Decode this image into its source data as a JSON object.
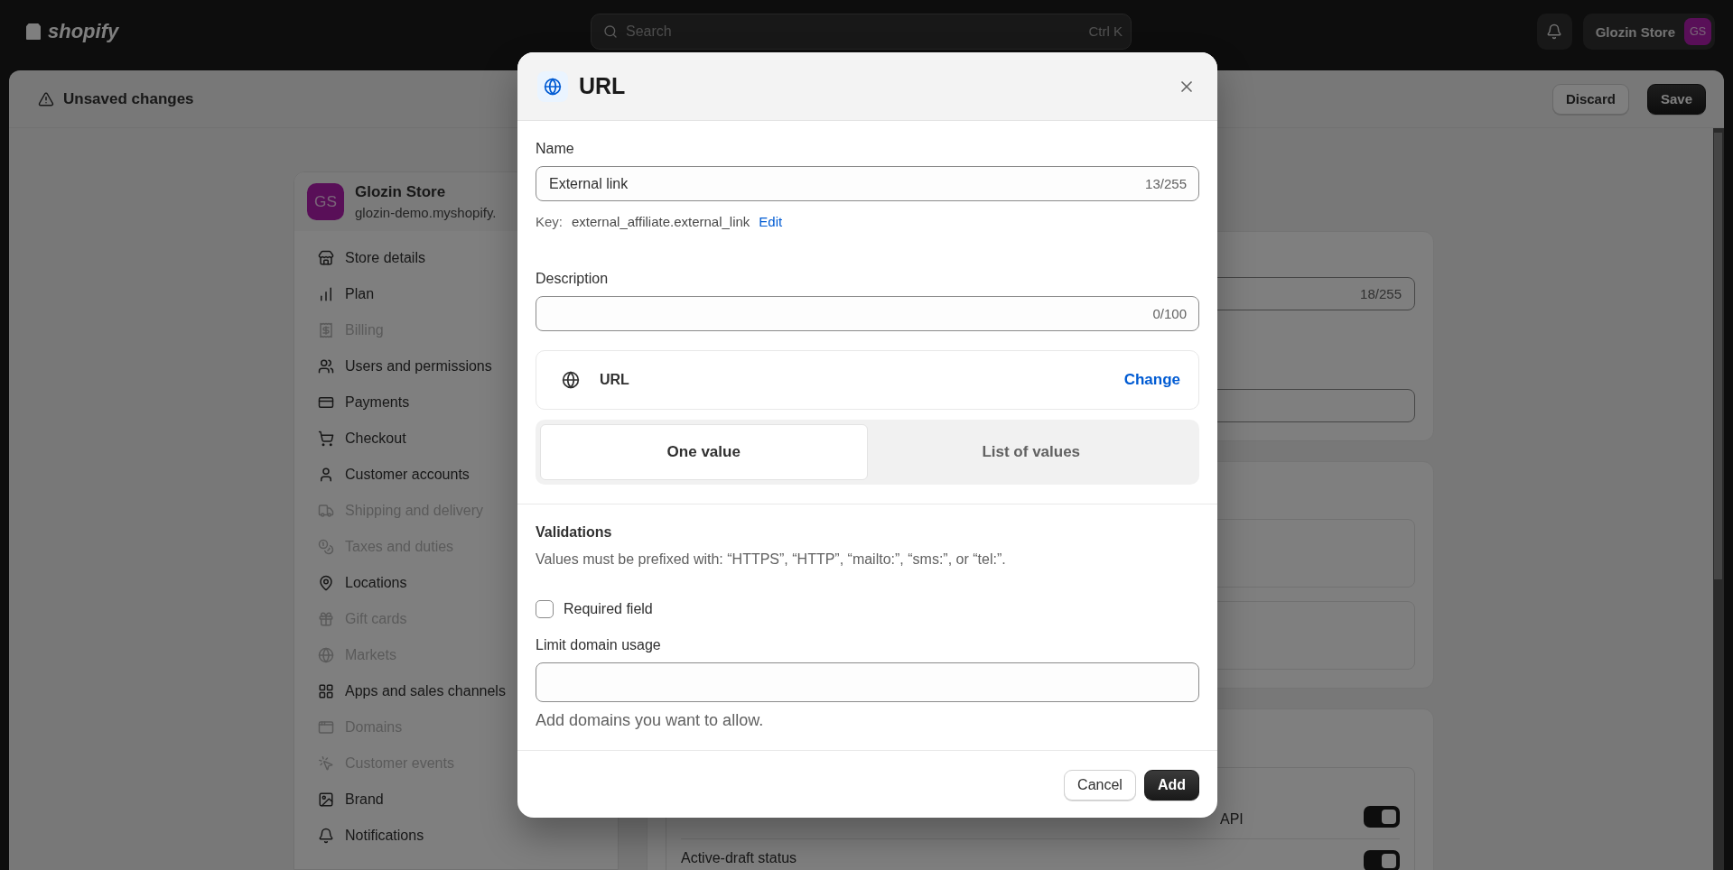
{
  "topbar": {
    "logo": "shopify",
    "search": {
      "placeholder": "Search",
      "shortcut": "Ctrl K"
    },
    "store_button": {
      "label": "Glozin Store",
      "avatar": "GS"
    }
  },
  "save_bar": {
    "title": "Unsaved changes",
    "buttons": [
      {
        "label": "Discard",
        "kind": "secondary"
      },
      {
        "label": "Save",
        "kind": "primary"
      }
    ]
  },
  "sidebar": {
    "store": {
      "avatar": "GS",
      "name": "Glozin Store",
      "domain": "glozin-demo.myshopify."
    },
    "items": [
      {
        "label": "Store details",
        "disabled": false
      },
      {
        "label": "Plan",
        "disabled": false
      },
      {
        "label": "Billing",
        "disabled": true
      },
      {
        "label": "Users and permissions",
        "disabled": false
      },
      {
        "label": "Payments",
        "disabled": false
      },
      {
        "label": "Checkout",
        "disabled": false
      },
      {
        "label": "Customer accounts",
        "disabled": false
      },
      {
        "label": "Shipping and delivery",
        "disabled": true
      },
      {
        "label": "Taxes and duties",
        "disabled": true
      },
      {
        "label": "Locations",
        "disabled": false
      },
      {
        "label": "Gift cards",
        "disabled": true
      },
      {
        "label": "Markets",
        "disabled": true
      },
      {
        "label": "Apps and sales channels",
        "disabled": false
      },
      {
        "label": "Domains",
        "disabled": true
      },
      {
        "label": "Customer events",
        "disabled": true
      },
      {
        "label": "Brand",
        "disabled": false
      },
      {
        "label": "Notifications",
        "disabled": false
      }
    ]
  },
  "background": {
    "name_counter": "18/255",
    "rows": [
      {
        "text": "API",
        "on": true
      },
      {
        "text": "Active-draft status",
        "on": true
      }
    ]
  },
  "modal": {
    "title": "URL",
    "name": {
      "label": "Name",
      "value": "External link",
      "counter": "13/255"
    },
    "key": {
      "label": "Key:",
      "value": "external_affiliate.external_link",
      "link": "Edit"
    },
    "description": {
      "label": "Description",
      "counter": "0/100"
    },
    "type": {
      "label": "URL",
      "action": "Change"
    },
    "modes": [
      {
        "label": "One value",
        "selected": true
      },
      {
        "label": "List of values",
        "selected": false
      }
    ],
    "validations": {
      "title": "Validations",
      "text": "Values must be prefixed with: “HTTPS”, “HTTP”, “mailto:”, “sms:”, or “tel:”.",
      "required": {
        "label": "Required field",
        "checked": false
      },
      "limit": {
        "label": "Limit domain usage",
        "help": "Add domains you want to allow."
      }
    },
    "buttons": [
      {
        "label": "Cancel",
        "kind": "secondary"
      },
      {
        "label": "Add",
        "kind": "primary"
      }
    ]
  }
}
